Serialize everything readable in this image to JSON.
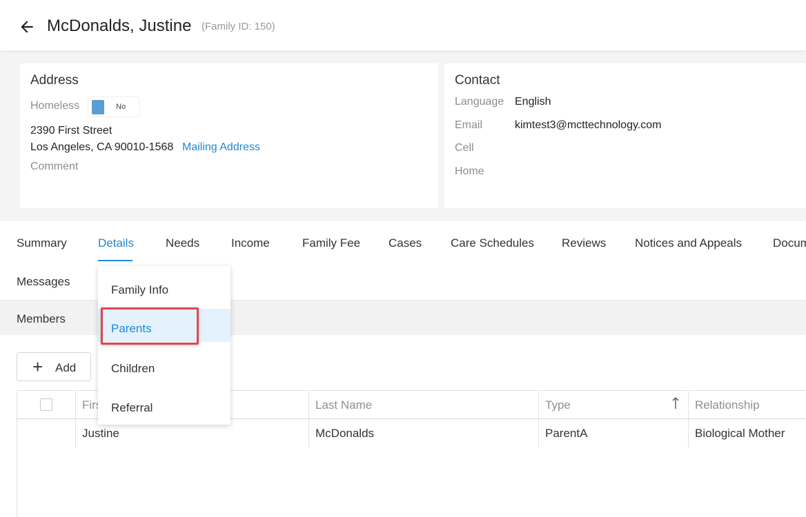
{
  "header": {
    "title": "McDonalds, Justine",
    "family_id": "(Family ID: 150)"
  },
  "address": {
    "title": "Address",
    "homeless_label": "Homeless",
    "homeless_toggle": "No",
    "street": "2390 First Street",
    "city_line": "Los Angeles, CA 90010-1568",
    "mailing_link": "Mailing Address",
    "comment_label": "Comment"
  },
  "contact": {
    "title": "Contact",
    "language_label": "Language",
    "language_value": "English",
    "email_label": "Email",
    "email_value": "kimtest3@mcttechnology.com",
    "cell_label": "Cell",
    "home_label": "Home"
  },
  "tabs": [
    {
      "label": "Summary"
    },
    {
      "label": "Details"
    },
    {
      "label": "Needs"
    },
    {
      "label": "Income"
    },
    {
      "label": "Family Fee"
    },
    {
      "label": "Cases"
    },
    {
      "label": "Care Schedules"
    },
    {
      "label": "Reviews"
    },
    {
      "label": "Notices and Appeals"
    },
    {
      "label": "Docum"
    },
    {
      "label": "Messages"
    }
  ],
  "active_tab": "Details",
  "subtab": {
    "label": "Members"
  },
  "dropdown": {
    "items": [
      {
        "label": "Family Info"
      },
      {
        "label": "Parents"
      },
      {
        "label": "Children"
      },
      {
        "label": "Referral"
      }
    ],
    "selected": "Parents"
  },
  "toolbar": {
    "add_label": "Add"
  },
  "grid": {
    "columns": [
      "Firs",
      "Last Name",
      "Type",
      "Relationship"
    ],
    "rows": [
      {
        "first_name": "Justine",
        "last_name": "McDonalds",
        "type": "ParentA",
        "relationship": "Biological Mother"
      }
    ]
  },
  "colors": {
    "accent": "#1e88d3",
    "highlight": "#e0484d",
    "toggle": "#5a9fd4"
  }
}
